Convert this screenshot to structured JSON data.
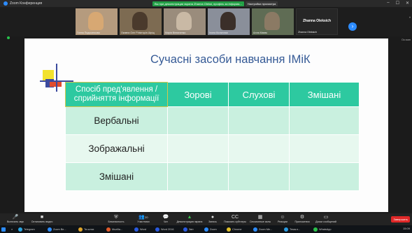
{
  "window": {
    "title": "Zoom Конференция",
    "share_banner": "Вы при демонстрации экрана Zhanna Oleksi, профіль за інформа...",
    "share_options": "Настройки просмотра"
  },
  "participants": [
    {
      "name": "Ганна Подосинкова"
    },
    {
      "name": "Окавна Оліг Ріліктор/а Шріщ"
    },
    {
      "name": "Марія Вінниченко"
    },
    {
      "name": "Ілона Кісличная"
    },
    {
      "name": "Алла Маєвс"
    }
  ],
  "active_speaker": {
    "name": "Zhanna Oleksich",
    "label": "Zhanna Oleksich"
  },
  "side_label": "Ок.ман",
  "slide": {
    "title": "Сучасні засоби навчання ІМіК",
    "table": {
      "header_first": "Спосіб пред'явлення / сприйняття інформації",
      "columns": [
        "Зорові",
        "Слухові",
        "Змішані"
      ],
      "rows": [
        {
          "label": "Вербальні"
        },
        {
          "label": "Зображальні"
        },
        {
          "label": "Змішані"
        }
      ]
    }
  },
  "toolbar": {
    "items": [
      {
        "icon": "microphone-icon",
        "label": "Включить звук"
      },
      {
        "icon": "camera-icon",
        "label": "Остановить видео"
      },
      {
        "icon": "shield-icon",
        "label": "Безопасность"
      },
      {
        "icon": "participants-icon",
        "label": "Участники",
        "count": "20"
      },
      {
        "icon": "chat-icon",
        "label": "Чат"
      },
      {
        "icon": "share-screen-icon",
        "label": "Демонстрация экрана"
      },
      {
        "icon": "record-icon",
        "label": "Запись"
      },
      {
        "icon": "cc-icon",
        "label": "Показать субтитры"
      },
      {
        "icon": "breakout-icon",
        "label": "Сессионные залы"
      },
      {
        "icon": "reactions-icon",
        "label": "Реакции"
      },
      {
        "icon": "apps-icon",
        "label": "Приложения"
      },
      {
        "icon": "whiteboard-icon",
        "label": "Доски сообщений"
      }
    ],
    "end_label": "Завершить"
  },
  "taskbar": {
    "items": [
      "Telegram",
      "Zoom Be...",
      "Тв.шлях",
      "Mozilla...",
      "Word",
      "Word 2016",
      "Звіт",
      "Zoom",
      "Chrome",
      "Zoom Me...",
      "Тема.п...",
      "WhatsApp"
    ],
    "tray_time": "15:09"
  },
  "colors": {
    "accent_green": "#2dc9a0",
    "cell_light": "#c9f0df",
    "cell_lighter": "#e7f8ef",
    "title_blue": "#355a96",
    "zoom_blue": "#2d8cff",
    "end_red": "#e02828"
  }
}
